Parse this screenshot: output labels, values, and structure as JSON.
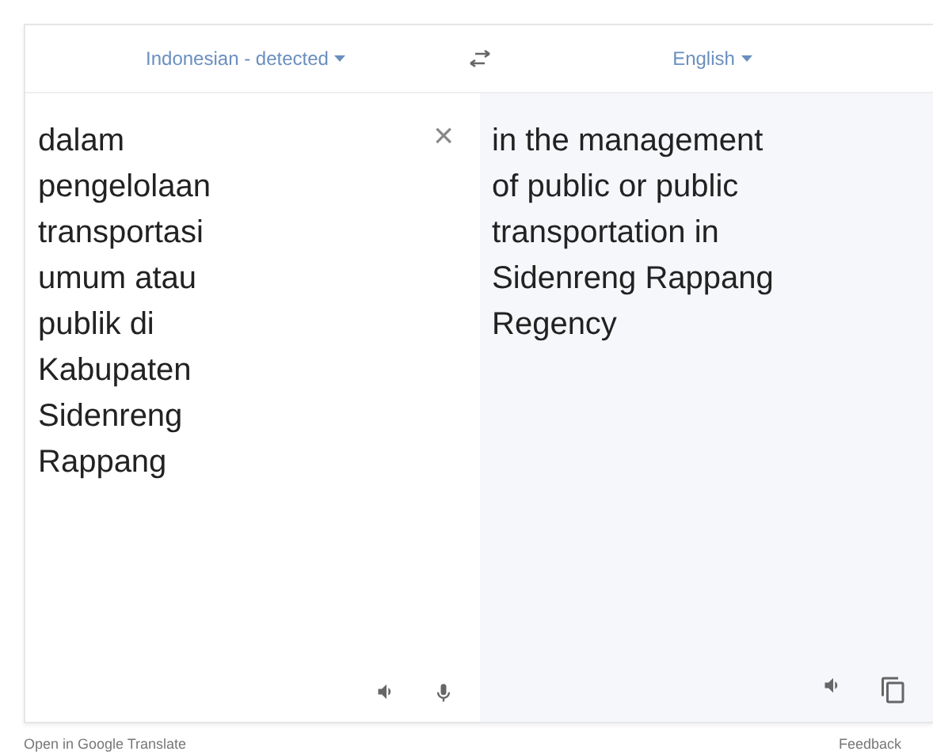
{
  "source_language": "Indonesian - detected",
  "target_language": "English",
  "source_lines": [
    "dalam",
    "pengelolaan",
    "transportasi",
    "umum atau",
    "publik di",
    "Kabupaten",
    "Sidenreng",
    "Rappang"
  ],
  "clear_button": "×",
  "target_lines": [
    "in the management",
    "of public or public",
    "transportation in",
    "Sidenreng Rappang",
    "Regency"
  ],
  "footer": {
    "left": "Open in Google Translate",
    "right": "Feedback"
  }
}
